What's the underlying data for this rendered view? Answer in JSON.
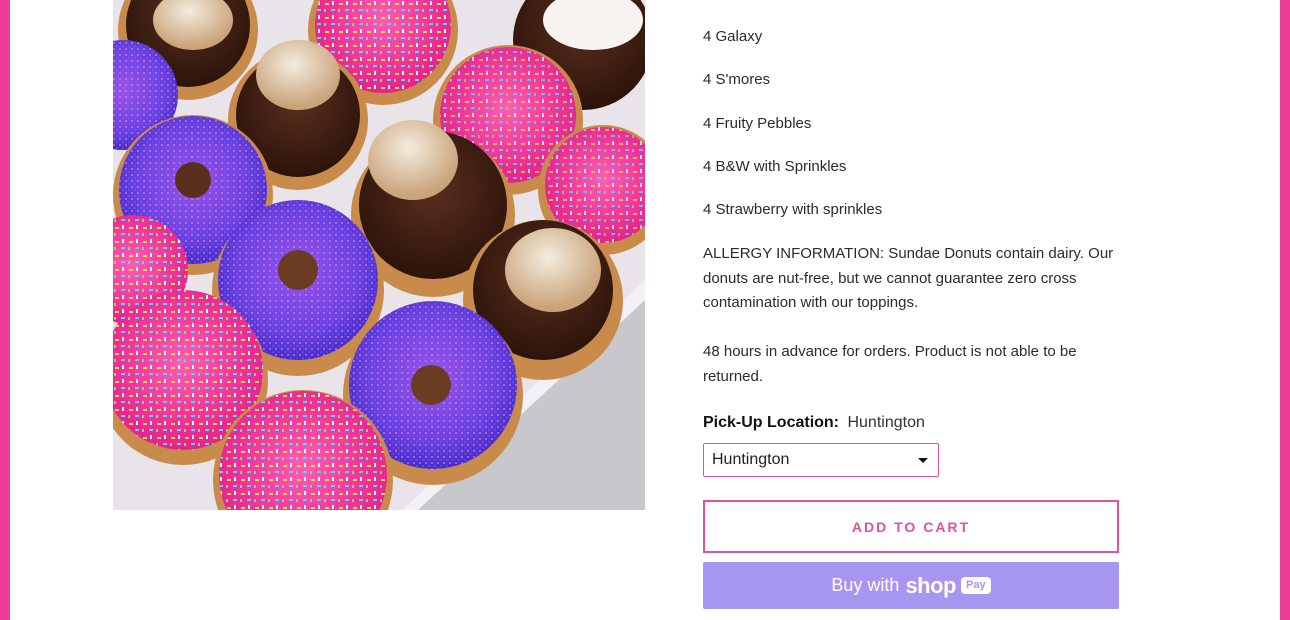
{
  "product": {
    "image_alt": "Box of assorted mini donuts"
  },
  "description": {
    "items": [
      "4 Galaxy",
      "4 S'mores",
      "4 Fruity Pebbles",
      "4 B&W with Sprinkles",
      "4 Strawberry with sprinkles"
    ],
    "allergy": "ALLERGY INFORMATION: Sundae Donuts contain dairy. Our donuts are nut-free, but we cannot guarantee zero cross contamination with our toppings.",
    "notice": "48 hours in advance for orders. Product is not able to be returned."
  },
  "option": {
    "label": "Pick-Up Location:",
    "value": "Huntington",
    "select_value": "Huntington"
  },
  "buttons": {
    "add_to_cart": "ADD TO CART",
    "buy_with": "Buy with",
    "shop": "shop",
    "pay": "Pay"
  },
  "colors": {
    "brand_pink": "#ee3d98",
    "shop_pay_purple": "#a795f2"
  }
}
